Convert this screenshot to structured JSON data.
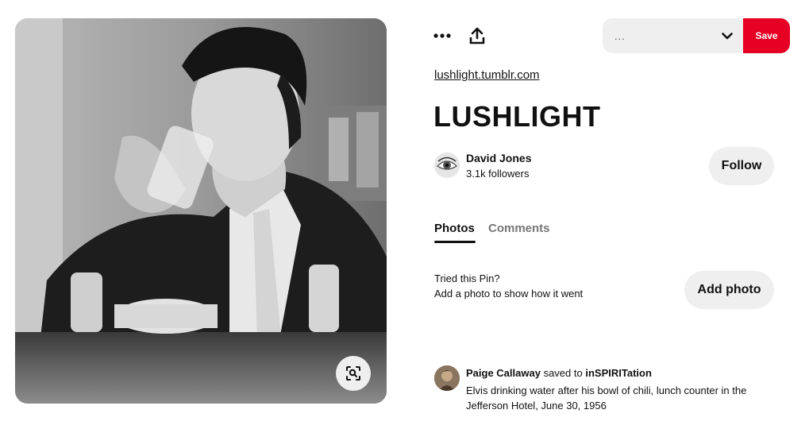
{
  "header": {
    "more_icon": "more-horizontal-icon",
    "share_icon": "share-upload-icon",
    "board_select": {
      "value": "...",
      "chevron_icon": "chevron-down-icon"
    },
    "save_label": "Save"
  },
  "pin": {
    "source_link": "lushlight.tumblr.com",
    "title": "LUSHLIGHT",
    "image_lens_icon": "visual-search-icon"
  },
  "creator": {
    "name": "David Jones",
    "followers": "3.1k followers",
    "follow_label": "Follow"
  },
  "tabs": [
    {
      "label": "Photos",
      "active": true
    },
    {
      "label": "Comments",
      "active": false
    }
  ],
  "tried": {
    "title": "Tried this Pin?",
    "subtitle": "Add a photo to show how it went",
    "button": "Add photo"
  },
  "activity": {
    "user": "Paige Callaway",
    "verb": "saved to",
    "board": "inSPIRITation",
    "description": "Elvis drinking water after his bowl of chili, lunch counter in the Jefferson Hotel, June 30, 1956"
  },
  "colors": {
    "save_red": "#e60023",
    "button_gray": "#efefef",
    "text": "#111111",
    "muted_tab": "#767676"
  }
}
